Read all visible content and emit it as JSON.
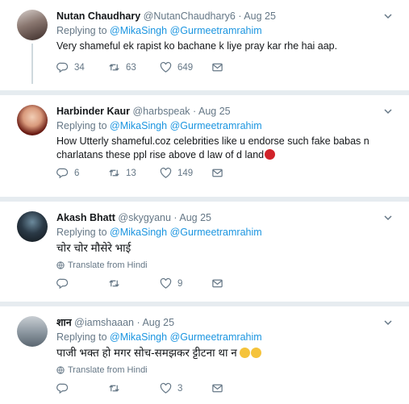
{
  "tweets": [
    {
      "fullname": "Nutan Chaudhary",
      "handle": "@NutanChaudhary6",
      "dot": "·",
      "time": "Aug 25",
      "replying_label": "Replying to",
      "replying_to": [
        "@MikaSingh",
        "@Gurmeetramrahim"
      ],
      "text": "Very shameful ek rapist ko bachane k liye pray kar rhe hai aap.",
      "replies": "34",
      "retweets": "63",
      "likes": "649"
    },
    {
      "fullname": "Harbinder Kaur",
      "handle": "@harbspeak",
      "dot": "·",
      "time": "Aug 25",
      "replying_label": "Replying to",
      "replying_to": [
        "@MikaSingh",
        "@Gurmeetramrahim"
      ],
      "text": "How Utterly shameful.coz celebrities like u endorse such fake babas n charlatans these ppl rise above d law of d land",
      "replies": "6",
      "retweets": "13",
      "likes": "149"
    },
    {
      "fullname": "Akash Bhatt",
      "handle": "@skygyanu",
      "dot": "·",
      "time": "Aug 25",
      "replying_label": "Replying to",
      "replying_to": [
        "@MikaSingh",
        "@Gurmeetramrahim"
      ],
      "text": "चोर चोर मौसेरे भाई",
      "translate": "Translate from Hindi",
      "replies": "",
      "retweets": "",
      "likes": "9"
    },
    {
      "fullname": "शान",
      "handle": "@iamshaaan",
      "dot": "·",
      "time": "Aug 25",
      "replying_label": "Replying to",
      "replying_to": [
        "@MikaSingh",
        "@Gurmeetramrahim"
      ],
      "text": "पाजी भक्त हो मगर सोच-समझकर ट्टीटना था न",
      "translate": "Translate from Hindi",
      "replies": "",
      "retweets": "",
      "likes": "3"
    }
  ]
}
